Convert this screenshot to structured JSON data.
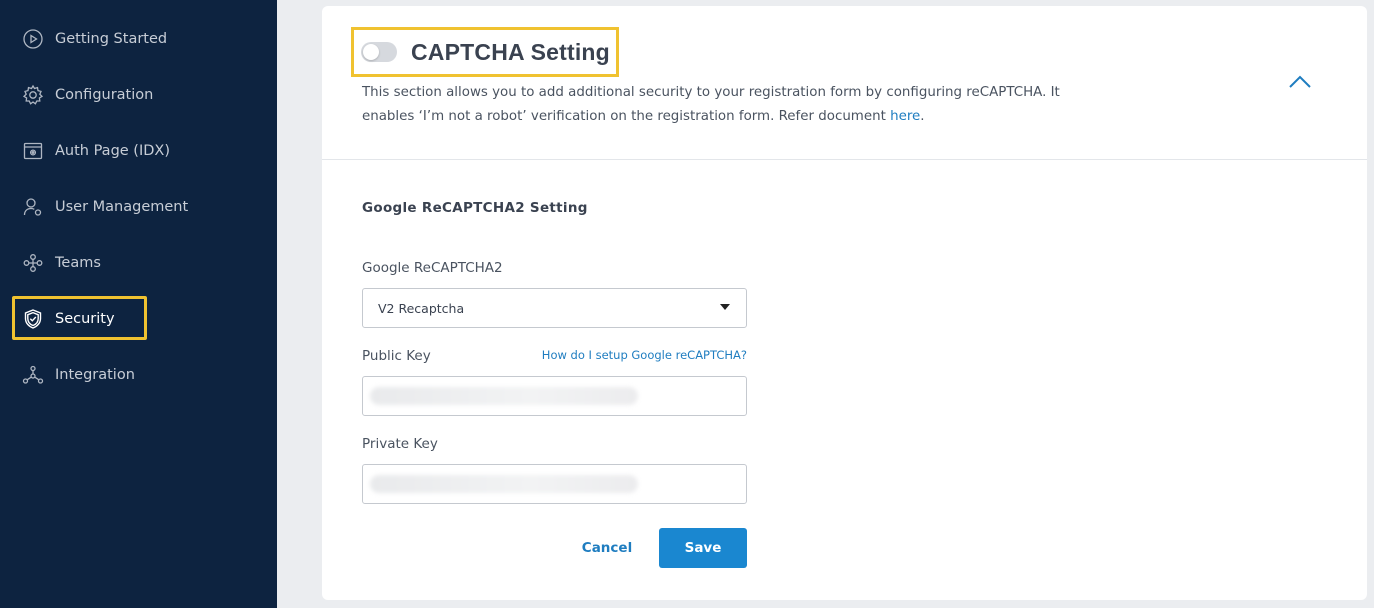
{
  "sidebar": {
    "items": [
      {
        "label": "Getting Started",
        "icon": "play-circle-icon"
      },
      {
        "label": "Configuration",
        "icon": "gear-icon"
      },
      {
        "label": "Auth Page (IDX)",
        "icon": "browser-gear-icon"
      },
      {
        "label": "User Management",
        "icon": "user-gear-icon"
      },
      {
        "label": "Teams",
        "icon": "teams-icon"
      },
      {
        "label": "Security",
        "icon": "shield-icon",
        "active": true
      },
      {
        "label": "Integration",
        "icon": "integration-icon"
      }
    ]
  },
  "captcha": {
    "title": "CAPTCHA Setting",
    "toggle_on": false,
    "description_1": "This section allows you to add additional security to your registration form by configuring reCAPTCHA. It enables ‘I’m not a robot’ verification on the registration form. Refer document ",
    "description_link": "here",
    "description_2": ".",
    "section_title": "Google ReCAPTCHA2 Setting",
    "recaptcha_label": "Google ReCAPTCHA2",
    "recaptcha_value": "V2 Recaptcha",
    "public_key_label": "Public Key",
    "help_link": "How do I setup Google reCAPTCHA?",
    "private_key_label": "Private Key",
    "cancel_label": "Cancel",
    "save_label": "Save"
  },
  "colors": {
    "sidebar_bg": "#0d2340",
    "highlight": "#f0c230",
    "accent": "#1a87d0"
  }
}
